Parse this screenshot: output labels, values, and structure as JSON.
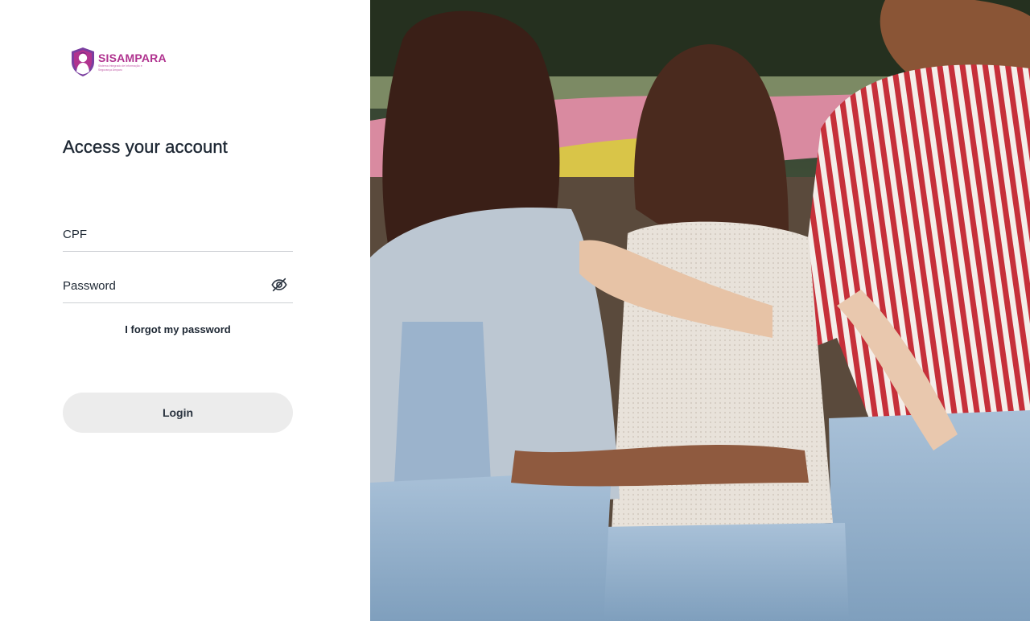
{
  "brand": {
    "name": "SISAMPARA",
    "tagline": "Sistema Integrado de Informação e Segurança Amparo",
    "logo_icon": "woman-silhouette-shield-icon",
    "color": "#b0338f"
  },
  "login": {
    "title": "Access your account",
    "cpf_placeholder": "CPF",
    "password_placeholder": "Password",
    "password_toggle_icon": "eye-off-icon",
    "forgot_label": "I forgot my password",
    "login_label": "Login"
  },
  "hero": {
    "image": "three-women-embracing-photo"
  },
  "colors": {
    "text": "#1d2733",
    "divider": "#cdd0d4",
    "button_bg": "#ececec",
    "accent": "#b0338f"
  }
}
